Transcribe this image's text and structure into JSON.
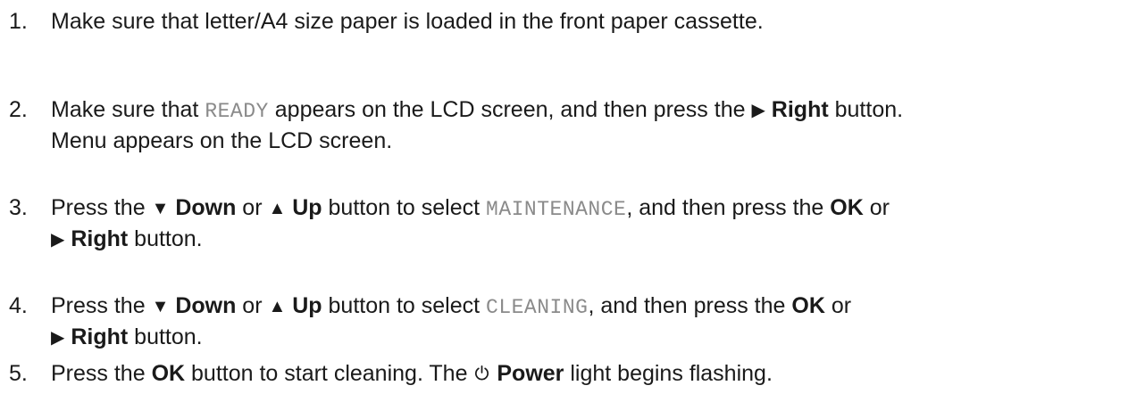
{
  "icons": {
    "right": "▶",
    "down": "▼",
    "up": "▲"
  },
  "steps": [
    {
      "number": "1.",
      "text": "Make sure that letter/A4 size paper is loaded in the front paper cassette."
    },
    {
      "number": "2.",
      "t1": "Make sure that ",
      "lcd": "READY",
      "t2": " appears on the LCD screen, and then press the ",
      "btn": "Right",
      "t3": " button.",
      "line2": "Menu appears on the LCD screen."
    },
    {
      "number": "3.",
      "t1": "Press the ",
      "btn_down": "Down",
      "t2": " or ",
      "btn_up": "Up",
      "t3": " button to select ",
      "lcd": "MAINTENANCE",
      "t4": ", and then press the ",
      "btn_ok": "OK",
      "t5": " or",
      "btn_right": "Right",
      "t6": " button."
    },
    {
      "number": "4.",
      "t1": "Press the ",
      "btn_down": "Down",
      "t2": " or ",
      "btn_up": "Up",
      "t3": " button to select ",
      "lcd": "CLEANING",
      "t4": ", and then press the ",
      "btn_ok": "OK",
      "t5": " or",
      "btn_right": "Right",
      "t6": " button."
    },
    {
      "number": "5.",
      "t1": "Press the ",
      "btn_ok": "OK",
      "t2": " button to start cleaning. The ",
      "icon": "power-icon",
      "btn_power": "Power",
      "t3": " light begins flashing."
    }
  ]
}
